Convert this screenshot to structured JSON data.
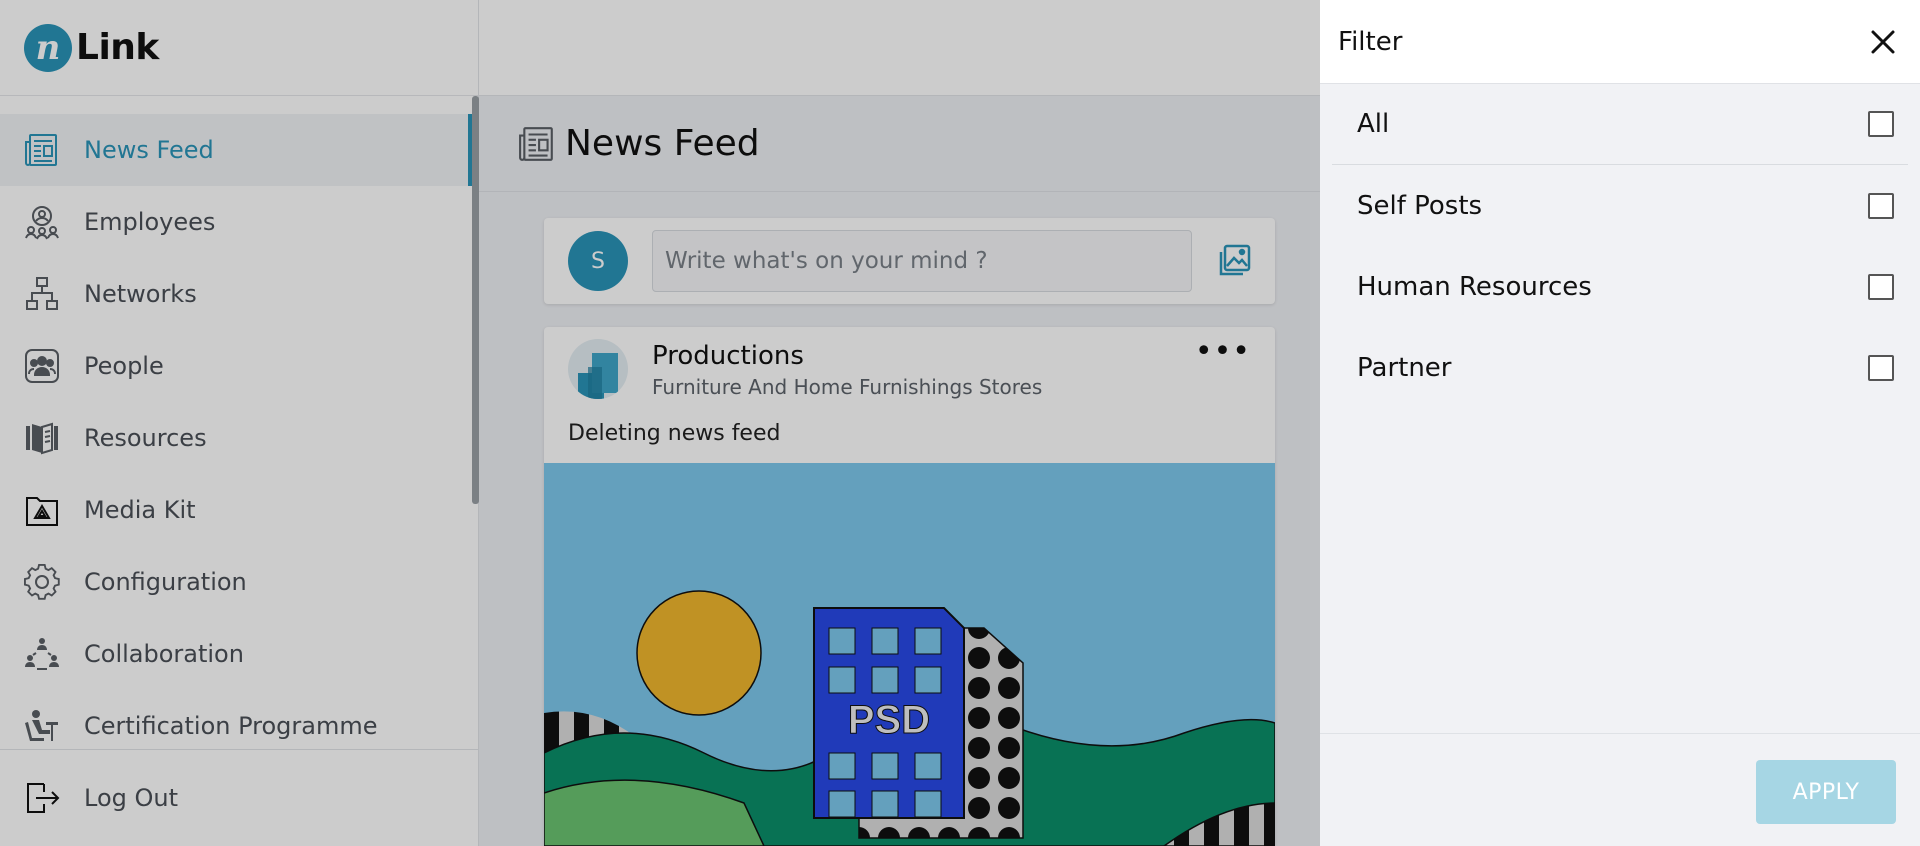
{
  "brand": {
    "mark": "n",
    "name": "Link"
  },
  "sidebar": {
    "items": [
      {
        "label": "News Feed",
        "icon": "newspaper-icon",
        "active": true
      },
      {
        "label": "Employees",
        "icon": "employees-icon"
      },
      {
        "label": "Networks",
        "icon": "network-icon"
      },
      {
        "label": "People",
        "icon": "people-icon"
      },
      {
        "label": "Resources",
        "icon": "book-icon"
      },
      {
        "label": "Media Kit",
        "icon": "media-kit-icon"
      },
      {
        "label": "Configuration",
        "icon": "gear-icon"
      },
      {
        "label": "Collaboration",
        "icon": "collaboration-icon"
      },
      {
        "label": "Certification Programme",
        "icon": "certification-icon"
      }
    ],
    "logout": {
      "label": "Log Out",
      "icon": "logout-icon"
    }
  },
  "page": {
    "title": "News Feed",
    "icon": "newspaper-icon"
  },
  "composer": {
    "avatar_initial": "S",
    "placeholder": "Write what's on your mind ?",
    "icon": "image-upload-icon"
  },
  "post": {
    "author": "Productions",
    "subtitle": "Furniture And Home Furnishings Stores",
    "text": "Deleting news feed",
    "menu": "•••",
    "image_label": "PSD"
  },
  "filter": {
    "title": "Filter",
    "options": [
      {
        "label": "All",
        "checked": false
      },
      {
        "label": "Self Posts",
        "checked": false
      },
      {
        "label": "Human Resources",
        "checked": false
      },
      {
        "label": "Partner",
        "checked": false
      }
    ],
    "apply_label": "APPLY"
  },
  "colors": {
    "accent": "#2a94b8",
    "apply_disabled": "#a6d6e4",
    "overlay": "rgba(0,0,0,0.2)"
  }
}
